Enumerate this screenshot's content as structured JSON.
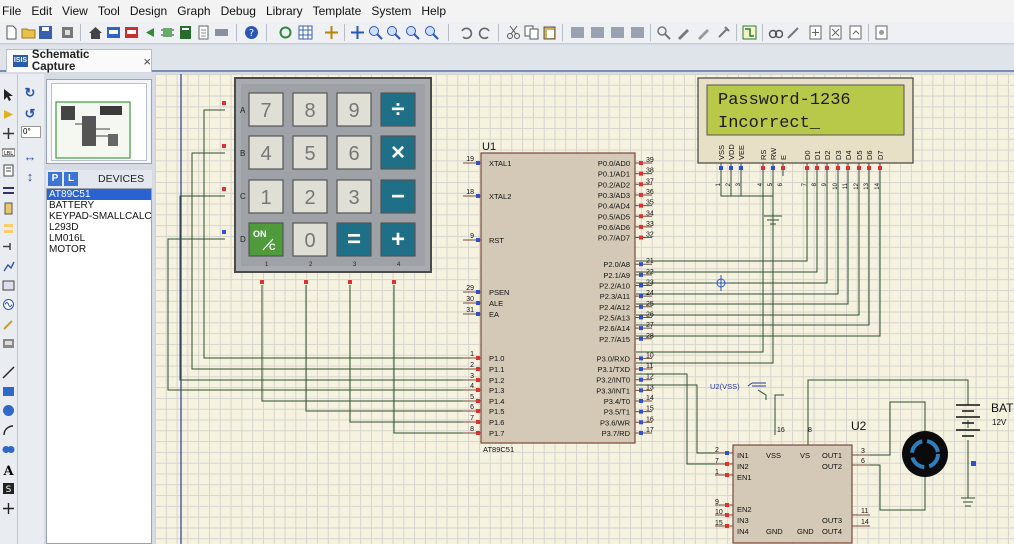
{
  "menu": [
    "File",
    "Edit",
    "View",
    "Tool",
    "Design",
    "Graph",
    "Debug",
    "Library",
    "Template",
    "System",
    "Help"
  ],
  "tab": {
    "title": "Schematic Capture",
    "close": "×"
  },
  "nav": {
    "zoom_field": "0°"
  },
  "devices": {
    "p_button": "P",
    "l_button": "L",
    "header": "DEVICES",
    "items": [
      "AT89C51",
      "BATTERY",
      "KEYPAD-SMALLCALC",
      "L293D",
      "LM016L",
      "MOTOR"
    ],
    "selected_index": 0
  },
  "keypad": {
    "rows": [
      "A",
      "B",
      "C",
      "D"
    ],
    "cols": [
      "1",
      "2",
      "3",
      "4"
    ],
    "keys": [
      [
        "7",
        "8",
        "9",
        "÷"
      ],
      [
        "4",
        "5",
        "6",
        "×"
      ],
      [
        "1",
        "2",
        "3",
        "−"
      ],
      [
        "ON/C",
        "0",
        "=",
        "+"
      ]
    ],
    "on_c": {
      "top": "ON",
      "bottom": "C"
    }
  },
  "mcu": {
    "ref": "U1",
    "part": "AT89C51",
    "left_pins": [
      {
        "num": "19",
        "name": "XTAL1"
      },
      {
        "num": "18",
        "name": "XTAL2"
      },
      {
        "num": "9",
        "name": "RST"
      },
      {
        "num": "29",
        "name": "PSEN"
      },
      {
        "num": "30",
        "name": "ALE"
      },
      {
        "num": "31",
        "name": "EA"
      },
      {
        "num": "1",
        "name": "P1.0"
      },
      {
        "num": "2",
        "name": "P1.1"
      },
      {
        "num": "3",
        "name": "P1.2"
      },
      {
        "num": "4",
        "name": "P1.3"
      },
      {
        "num": "5",
        "name": "P1.4"
      },
      {
        "num": "6",
        "name": "P1.5"
      },
      {
        "num": "7",
        "name": "P1.6"
      },
      {
        "num": "8",
        "name": "P1.7"
      }
    ],
    "right_pins": [
      {
        "num": "39",
        "name": "P0.0/AD0"
      },
      {
        "num": "38",
        "name": "P0.1/AD1"
      },
      {
        "num": "37",
        "name": "P0.2/AD2"
      },
      {
        "num": "36",
        "name": "P0.3/AD3"
      },
      {
        "num": "35",
        "name": "P0.4/AD4"
      },
      {
        "num": "34",
        "name": "P0.5/AD5"
      },
      {
        "num": "33",
        "name": "P0.6/AD6"
      },
      {
        "num": "32",
        "name": "P0.7/AD7"
      },
      {
        "num": "21",
        "name": "P2.0/A8"
      },
      {
        "num": "22",
        "name": "P2.1/A9"
      },
      {
        "num": "23",
        "name": "P2.2/A10"
      },
      {
        "num": "24",
        "name": "P2.3/A11"
      },
      {
        "num": "25",
        "name": "P2.4/A12"
      },
      {
        "num": "26",
        "name": "P2.5/A13"
      },
      {
        "num": "27",
        "name": "P2.6/A14"
      },
      {
        "num": "28",
        "name": "P2.7/A15"
      },
      {
        "num": "10",
        "name": "P3.0/RXD"
      },
      {
        "num": "11",
        "name": "P3.1/TXD"
      },
      {
        "num": "12",
        "name": "P3.2/INT0"
      },
      {
        "num": "13",
        "name": "P3.3/INT1"
      },
      {
        "num": "14",
        "name": "P3.4/T0"
      },
      {
        "num": "15",
        "name": "P3.5/T1"
      },
      {
        "num": "16",
        "name": "P3.6/WR"
      },
      {
        "num": "17",
        "name": "P3.7/RD"
      }
    ]
  },
  "lcd": {
    "line1": "Password-1236",
    "line2": "Incorrect_",
    "pin_labels": [
      "VSS",
      "VDD",
      "VEE",
      "RS",
      "RW",
      "E",
      "D0",
      "D1",
      "D2",
      "D3",
      "D4",
      "D5",
      "D6",
      "D7"
    ],
    "pin_numbers": [
      "1",
      "2",
      "3",
      "4",
      "5",
      "6",
      "7",
      "8",
      "9",
      "10",
      "11",
      "12",
      "13",
      "14"
    ]
  },
  "driver": {
    "ref": "U2",
    "vss_tag": "U2(VSS)",
    "top_pins": [
      "16",
      "8"
    ],
    "labels": {
      "in1": "IN1",
      "in2": "IN2",
      "en1": "EN1",
      "vss": "VSS",
      "vs": "VS",
      "out1": "OUT1",
      "out2": "OUT2",
      "en2": "EN2",
      "in3": "IN3",
      "in4": "IN4",
      "gnd1": "GND",
      "gnd2": "GND",
      "out3": "OUT3",
      "out4": "OUT4"
    },
    "left_nums": [
      "2",
      "7",
      "1",
      "9",
      "10",
      "15"
    ],
    "right_nums": [
      "3",
      "6",
      "11",
      "14"
    ]
  },
  "battery": {
    "ref": "BAT",
    "value": "12V"
  }
}
